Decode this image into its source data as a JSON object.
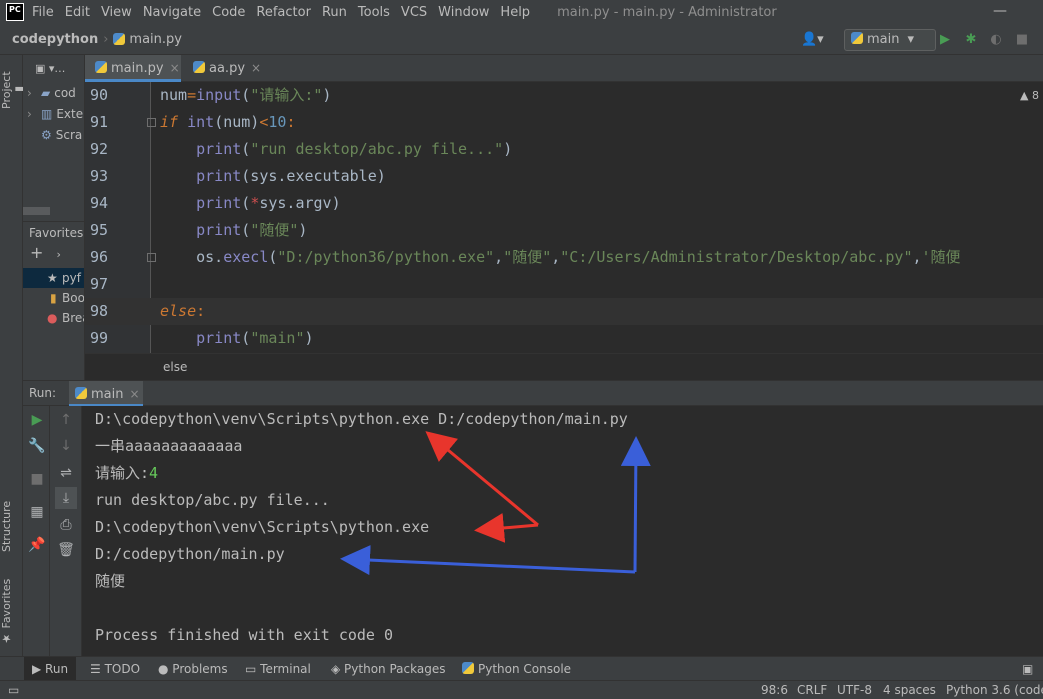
{
  "menubar": {
    "logo": "PC",
    "items": [
      "File",
      "Edit",
      "View",
      "Navigate",
      "Code",
      "Refactor",
      "Run",
      "Tools",
      "VCS",
      "Window",
      "Help"
    ],
    "window_title": "main.py - main.py - Administrator"
  },
  "navbar": {
    "project": "codepython",
    "file": "main.py",
    "run_config": "main"
  },
  "left_strip": {
    "project_tab": "Project",
    "structure_tab": "Structure",
    "favorites_tab": "Favorites"
  },
  "project_panel": {
    "tree": [
      "cod",
      "Exte",
      "Scra"
    ],
    "favorites_header": "Favorites",
    "favorites": [
      "pyf",
      "Boo",
      "Brea"
    ]
  },
  "editor": {
    "tabs": [
      "main.py",
      "aa.py"
    ],
    "warning": "8",
    "lines": [
      {
        "num": "90",
        "tokens": [
          [
            "fn",
            "num"
          ],
          [
            "op",
            "="
          ],
          [
            "bi",
            "input"
          ],
          [
            "fn",
            "("
          ],
          [
            "str",
            "\"请输入:\""
          ],
          [
            "fn",
            ")"
          ]
        ]
      },
      {
        "num": "91",
        "tokens": [
          [
            "kw",
            "if"
          ],
          [
            "fn",
            " "
          ],
          [
            "bi",
            "int"
          ],
          [
            "fn",
            "(num)"
          ],
          [
            "op",
            "<"
          ],
          [
            "num",
            "10"
          ],
          [
            "op",
            ":"
          ]
        ]
      },
      {
        "num": "92",
        "tokens": [
          [
            "fn",
            "    "
          ],
          [
            "bi",
            "print"
          ],
          [
            "fn",
            "("
          ],
          [
            "str",
            "\"run desktop/abc.py file...\""
          ],
          [
            "fn",
            ")"
          ]
        ]
      },
      {
        "num": "93",
        "tokens": [
          [
            "fn",
            "    "
          ],
          [
            "bi",
            "print"
          ],
          [
            "fn",
            "(sys.executable)"
          ]
        ]
      },
      {
        "num": "94",
        "tokens": [
          [
            "fn",
            "    "
          ],
          [
            "bi",
            "print"
          ],
          [
            "fn",
            "("
          ],
          [
            "star",
            "*"
          ],
          [
            "fn",
            "sys.argv)"
          ]
        ]
      },
      {
        "num": "95",
        "tokens": [
          [
            "fn",
            "    "
          ],
          [
            "bi",
            "print"
          ],
          [
            "fn",
            "("
          ],
          [
            "str",
            "\"随便\""
          ],
          [
            "fn",
            ")"
          ]
        ]
      },
      {
        "num": "96",
        "tokens": [
          [
            "fn",
            "    os."
          ],
          [
            "bi",
            "execl"
          ],
          [
            "fn",
            "("
          ],
          [
            "str",
            "\"D:/python36/python.exe\""
          ],
          [
            "fn",
            ","
          ],
          [
            "str",
            "\"随便\""
          ],
          [
            "fn",
            ","
          ],
          [
            "str",
            "\"C:/Users/Administrator/Desktop/abc.py\""
          ],
          [
            "fn",
            ","
          ],
          [
            "str",
            "'随便"
          ]
        ]
      },
      {
        "num": "97",
        "tokens": []
      },
      {
        "num": "98",
        "tokens": [
          [
            "kw",
            "else"
          ],
          [
            "op",
            ":"
          ]
        ]
      },
      {
        "num": "99",
        "tokens": [
          [
            "fn",
            "    "
          ],
          [
            "bi",
            "print"
          ],
          [
            "fn",
            "("
          ],
          [
            "str",
            "\"main\""
          ],
          [
            "fn",
            ")"
          ]
        ]
      }
    ],
    "breadcrumb": "else"
  },
  "run_panel": {
    "label": "Run:",
    "tab": "main",
    "console": [
      "D:\\codepython\\venv\\Scripts\\python.exe D:/codepython/main.py",
      "一串aaaaaaaaaaaaa",
      "请输入:",
      "run desktop/abc.py file...",
      "D:\\codepython\\venv\\Scripts\\python.exe",
      "D:/codepython/main.py",
      "随便",
      "",
      "Process finished with exit code 0"
    ],
    "user_input": "4"
  },
  "bottom_tabs": [
    "Run",
    "TODO",
    "Problems",
    "Terminal",
    "Python Packages",
    "Python Console"
  ],
  "statusbar": {
    "position": "98:6",
    "line_sep": "CRLF",
    "encoding": "UTF-8",
    "indent": "4 spaces",
    "interpreter": "Python 3.6 (code"
  },
  "colors": {
    "arrow_red": "#e8352c",
    "arrow_blue": "#3a5fd9",
    "accent": "#4a88c7",
    "run_green": "#499c54"
  }
}
